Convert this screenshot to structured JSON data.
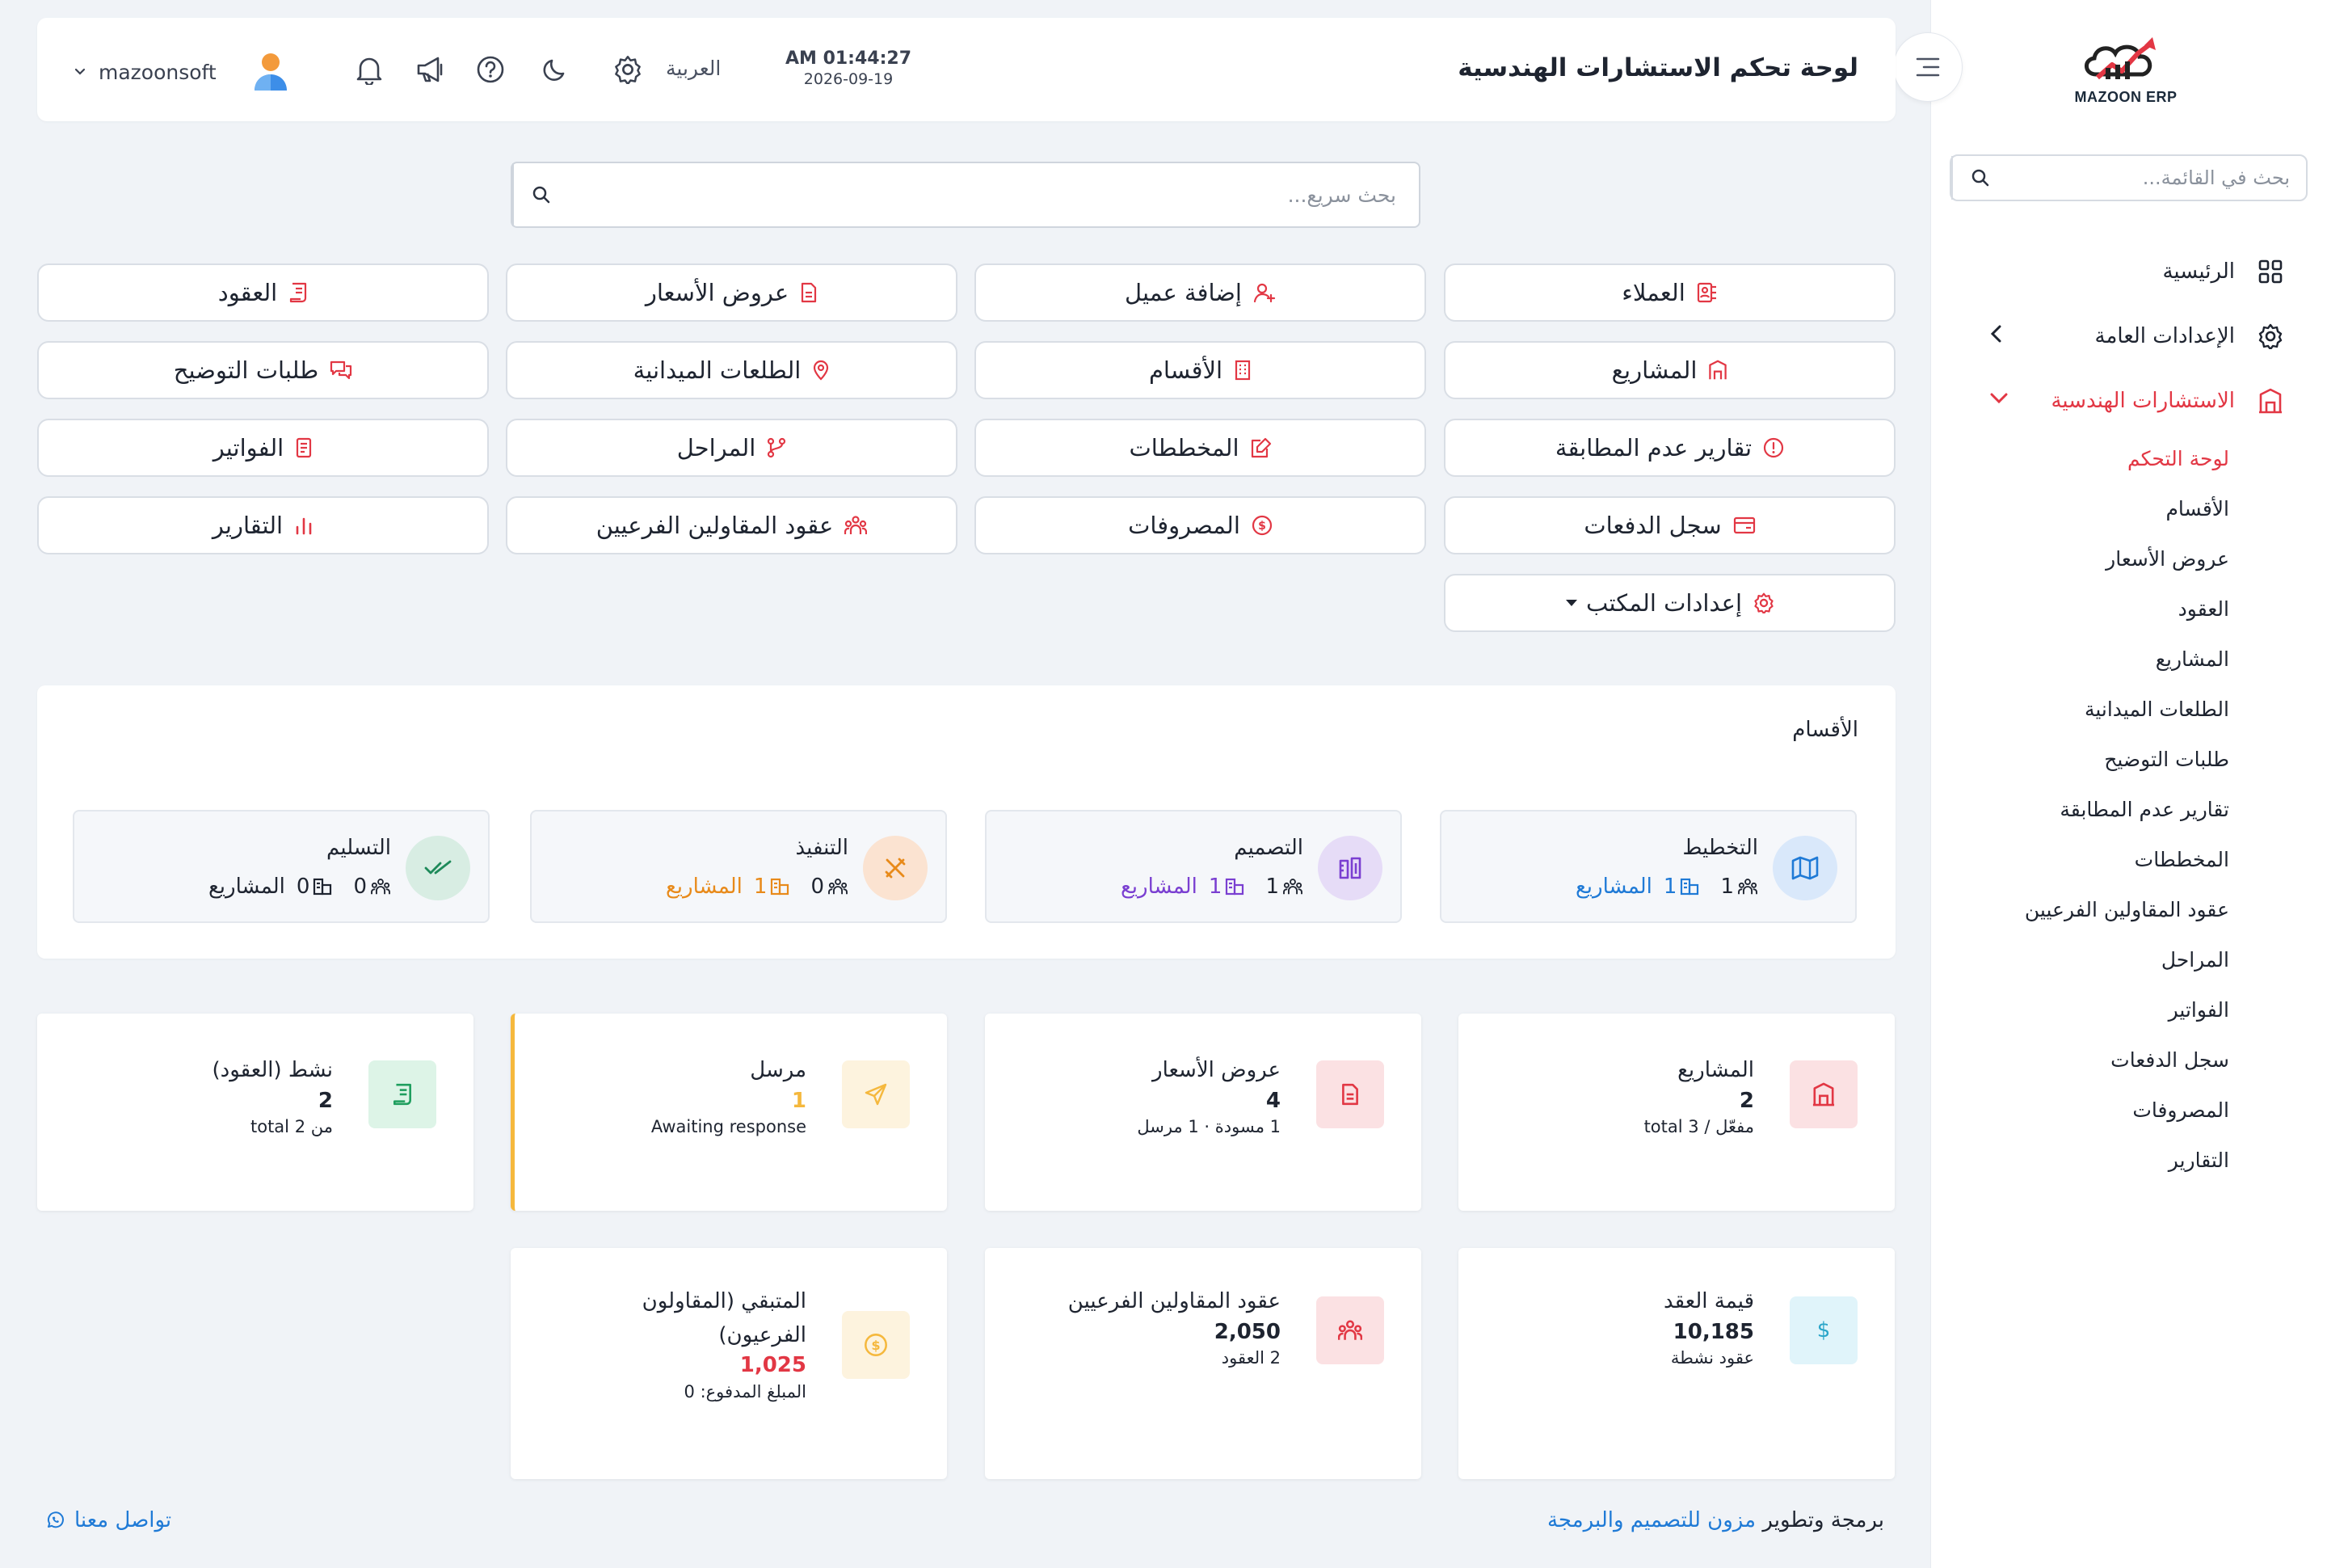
{
  "sidebar": {
    "logo_text": "MAZOON ERP",
    "search_placeholder": "بحث في القائمة...",
    "items": [
      {
        "label": "الرئيسية",
        "icon": "grid-icon"
      },
      {
        "label": "الإعدادات العامة",
        "icon": "gear-icon"
      },
      {
        "label": "الاستشارات الهندسية",
        "icon": "building-icon"
      }
    ],
    "submenu": [
      "لوحة التحكم",
      "الأقسام",
      "عروض الأسعار",
      "العقود",
      "المشاريع",
      "الطلعات الميدانية",
      "طلبات التوضيح",
      "تقارير عدم المطابقة",
      "المخططات",
      "عقود المقاولين الفرعيين",
      "المراحل",
      "الفواتير",
      "سجل الدفعات",
      "المصروفات",
      "التقارير"
    ]
  },
  "header": {
    "title": "لوحة تحكم الاستشارات الهندسية",
    "time": "AM 01:44:27",
    "date": "2026-09-19",
    "language": "العربية",
    "username": "mazoonsoft"
  },
  "quick_search": {
    "placeholder": "بحث سريع..."
  },
  "quick_buttons": [
    {
      "label": "العملاء",
      "icon": "clients-icon"
    },
    {
      "label": "إضافة عميل",
      "icon": "add-user-icon"
    },
    {
      "label": "عروض الأسعار",
      "icon": "document-icon"
    },
    {
      "label": "العقود",
      "icon": "contract-icon"
    },
    {
      "label": "المشاريع",
      "icon": "building-icon"
    },
    {
      "label": "الأقسام",
      "icon": "office-icon"
    },
    {
      "label": "الطلعات الميدانية",
      "icon": "location-pin-icon"
    },
    {
      "label": "طلبات التوضيح",
      "icon": "chat-icon"
    },
    {
      "label": "تقارير عدم المطابقة",
      "icon": "alert-circle-icon"
    },
    {
      "label": "المخططات",
      "icon": "edit-plan-icon"
    },
    {
      "label": "المراحل",
      "icon": "branch-icon"
    },
    {
      "label": "الفواتير",
      "icon": "invoice-icon"
    },
    {
      "label": "سجل الدفعات",
      "icon": "wallet-icon"
    },
    {
      "label": "المصروفات",
      "icon": "coin-icon"
    },
    {
      "label": "عقود المقاولين الفرعيين",
      "icon": "team-icon"
    },
    {
      "label": "التقارير",
      "icon": "bar-chart-icon"
    },
    {
      "label": "إعدادات المكتب",
      "icon": "settings-icon"
    }
  ],
  "departments": {
    "title": "الأقسام",
    "projects_label": "المشاريع",
    "items": [
      {
        "name": "التخطيط",
        "members": "1",
        "projects": "1",
        "color": "#1f7ad6",
        "icon": "map-icon"
      },
      {
        "name": "التصميم",
        "members": "1",
        "projects": "1",
        "color": "#7a3fd1",
        "icon": "design-icon"
      },
      {
        "name": "التنفيذ",
        "members": "0",
        "projects": "1",
        "color": "#e88a1a",
        "icon": "tools-icon"
      },
      {
        "name": "التسليم",
        "members": "0",
        "projects": "0",
        "color": "#1e2430",
        "icon": "double-check-icon"
      }
    ]
  },
  "stats": [
    {
      "label": "المشاريع",
      "value": "2",
      "sub": "مفعّل / 3 total",
      "value_color": "#1e2430",
      "icon": "building-icon"
    },
    {
      "label": "عروض الأسعار",
      "value": "4",
      "sub": "1 مسودة · 1 مرسل",
      "value_color": "#1e2430",
      "icon": "document-icon"
    },
    {
      "label": "مرسل",
      "value": "1",
      "sub": "Awaiting response",
      "value_color": "#f5b83d",
      "icon": "send-icon"
    },
    {
      "label": "نشط (العقود)",
      "value": "2",
      "sub": "من 2 total",
      "value_color": "#1e2430",
      "icon": "contract-icon"
    },
    {
      "label": "قيمة العقد",
      "value": "10,185",
      "sub": "عقود نشطة",
      "value_color": "#1e2430",
      "icon": "dollar-icon"
    },
    {
      "label": "عقود المقاولين الفرعيين",
      "value": "2,050",
      "sub": "2 العقود",
      "value_color": "#1e2430",
      "icon": "team-icon"
    },
    {
      "label": "المتبقي (المقاولون الفرعيون)",
      "value": "1,025",
      "sub": "المبلغ المدفوع: 0",
      "value_color": "#e23744",
      "icon": "coin-icon"
    }
  ],
  "footer": {
    "credit_prefix": "برمجة وتطوير",
    "credit_link": "مزون للتصميم والبرمجة",
    "contact": "تواصل معنا"
  }
}
